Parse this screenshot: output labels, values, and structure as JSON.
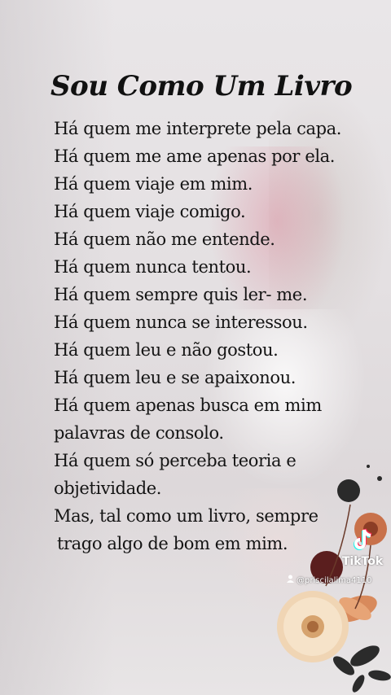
{
  "title": "Sou Como Um Livro",
  "poem": [
    "Há quem me interprete pela capa.",
    "Há quem me ame apenas por ela.",
    "Há quem viaje em mim.",
    "Há quem viaje comigo.",
    "Há quem não me entende.",
    "Há quem nunca tentou.",
    "Há quem sempre quis ler- me.",
    "Há quem nunca se interessou.",
    "Há quem leu e não gostou.",
    "Há quem leu e se apaixonou.",
    "Há quem apenas busca em mim",
    "palavras de consolo.",
    "Há quem só perceba teoria e",
    "objetividade.",
    "Mas, tal como um livro, sempre",
    "trago algo de bom em mim."
  ],
  "watermark": {
    "brand": "TikTok",
    "username": "@priscilalima4110",
    "icon": "tiktok-logo-icon",
    "user_icon": "person-icon"
  },
  "colors": {
    "text": "#141414",
    "flower_orange": "#c8714a",
    "flower_cream": "#f2d9b8",
    "leaf_dark": "#2b2b2b"
  }
}
